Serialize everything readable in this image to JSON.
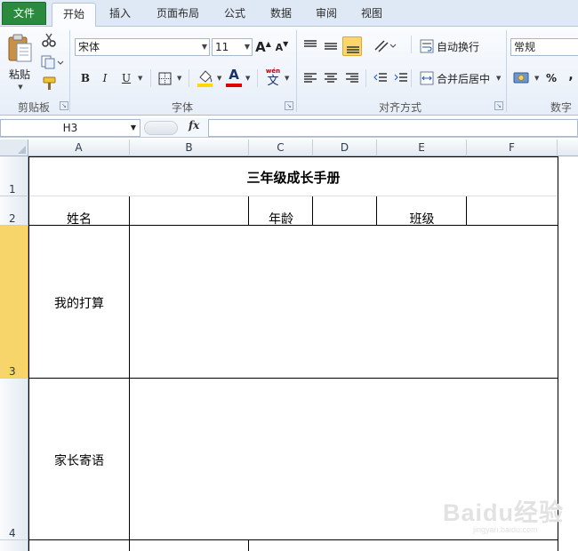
{
  "ribbon_tabs": [
    {
      "label": "文件"
    },
    {
      "label": "开始"
    },
    {
      "label": "插入"
    },
    {
      "label": "页面布局"
    },
    {
      "label": "公式"
    },
    {
      "label": "数据"
    },
    {
      "label": "审阅"
    },
    {
      "label": "视图"
    }
  ],
  "active_tab": "开始",
  "accent_colors": {
    "file_tab": "#2a8a3e",
    "fill_color": "#ffd800",
    "font_color": "#e00000",
    "selected_row": "#f7d56b"
  },
  "clipboard": {
    "paste_label": "粘贴",
    "group_label": "剪贴板"
  },
  "font": {
    "name": "宋体",
    "size": "11",
    "group_label": "字体",
    "bold": "B",
    "italic": "I",
    "underline": "U",
    "grow": "A",
    "shrink": "A",
    "phonetic_top": "wén",
    "phonetic_bottom": "文",
    "font_color_letter": "A"
  },
  "alignment": {
    "wrap_label": "自动换行",
    "merge_label": "合并后居中",
    "group_label": "对齐方式"
  },
  "number": {
    "format": "常规",
    "percent": "%",
    "comma": ",",
    "group_label": "数字"
  },
  "formula_bar": {
    "name_box": "H3",
    "fx": "fx",
    "content": ""
  },
  "sheet": {
    "columns": [
      "A",
      "B",
      "C",
      "D",
      "E",
      "F"
    ],
    "rows": [
      "1",
      "2",
      "3",
      "4"
    ],
    "selected_row": "3",
    "cells": {
      "title": "三年级成长手册",
      "name_label": "姓名",
      "age_label": "年龄",
      "class_label": "班级",
      "plan_label": "我的打算",
      "parent_label": "家长寄语"
    }
  },
  "watermark": {
    "main": "Baidu经验",
    "sub": "jingyan.baidu.com"
  }
}
